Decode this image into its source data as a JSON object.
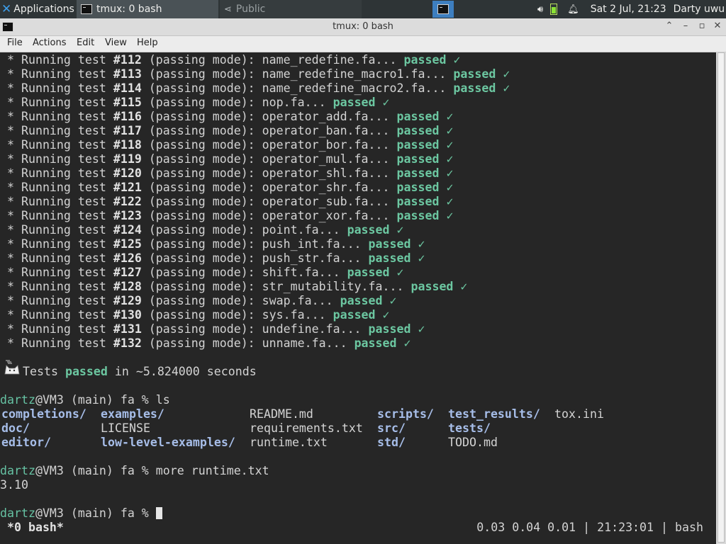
{
  "panel": {
    "apps_label": "Applications",
    "task_active": "tmux: 0 bash",
    "task_inactive": "Public",
    "clock": "Sat  2 Jul, 21:23",
    "user": "Darty uwu",
    "icons": [
      "xfce-logo-icon",
      "terminal-icon",
      "share-icon",
      "volume-icon",
      "battery-icon",
      "bell-icon"
    ]
  },
  "window": {
    "title": "tmux: 0 bash"
  },
  "menu": {
    "file": "File",
    "actions": "Actions",
    "edit": "Edit",
    "view": "View",
    "help": "Help"
  },
  "terminal": {
    "tests": [
      {
        "num": "#112",
        "file": "name_redefine.fa"
      },
      {
        "num": "#113",
        "file": "name_redefine_macro1.fa"
      },
      {
        "num": "#114",
        "file": "name_redefine_macro2.fa"
      },
      {
        "num": "#115",
        "file": "nop.fa"
      },
      {
        "num": "#116",
        "file": "operator_add.fa"
      },
      {
        "num": "#117",
        "file": "operator_ban.fa"
      },
      {
        "num": "#118",
        "file": "operator_bor.fa"
      },
      {
        "num": "#119",
        "file": "operator_mul.fa"
      },
      {
        "num": "#120",
        "file": "operator_shl.fa"
      },
      {
        "num": "#121",
        "file": "operator_shr.fa"
      },
      {
        "num": "#122",
        "file": "operator_sub.fa"
      },
      {
        "num": "#123",
        "file": "operator_xor.fa"
      },
      {
        "num": "#124",
        "file": "point.fa"
      },
      {
        "num": "#125",
        "file": "push_int.fa"
      },
      {
        "num": "#126",
        "file": "push_str.fa"
      },
      {
        "num": "#127",
        "file": "shift.fa"
      },
      {
        "num": "#128",
        "file": "str_mutability.fa"
      },
      {
        "num": "#129",
        "file": "swap.fa"
      },
      {
        "num": "#130",
        "file": "sys.fa"
      },
      {
        "num": "#131",
        "file": "undefine.fa"
      },
      {
        "num": "#132",
        "file": "unname.fa"
      }
    ],
    "test_prefix": " * Running test ",
    "test_mode": " (passing mode): ",
    "ellipsis": "... ",
    "passed": "passed",
    "check": " ✓",
    "summary_pre": "Tests ",
    "summary_passed": "passed",
    "summary_post": " in ~5.824000 seconds",
    "prompt_user": "dartz",
    "prompt_rest": "@VM3 (main) fa % ",
    "cmd_ls": "ls",
    "ls_rows": [
      [
        {
          "t": "completions/",
          "d": true
        },
        {
          "t": "examples/",
          "d": true
        },
        {
          "t": "README.md",
          "d": false
        },
        {
          "t": "scripts/",
          "d": true
        },
        {
          "t": "test_results/",
          "d": true
        },
        {
          "t": "tox.ini",
          "d": false
        }
      ],
      [
        {
          "t": "doc/",
          "d": true
        },
        {
          "t": "LICENSE",
          "d": false
        },
        {
          "t": "requirements.txt",
          "d": false
        },
        {
          "t": "src/",
          "d": true
        },
        {
          "t": "tests/",
          "d": true
        }
      ],
      [
        {
          "t": "editor/",
          "d": true
        },
        {
          "t": "low-level-examples/",
          "d": true
        },
        {
          "t": "runtime.txt",
          "d": false
        },
        {
          "t": "std/",
          "d": true
        },
        {
          "t": "TODO.md",
          "d": false
        }
      ]
    ],
    "cmd_more": "more runtime.txt",
    "runtime_output": "3.10"
  },
  "tmux_status": {
    "window": " *0 bash*",
    "load": "0.03 0.04 0.01",
    "time": "21:23:01",
    "host": "bash",
    "sep": " | "
  }
}
